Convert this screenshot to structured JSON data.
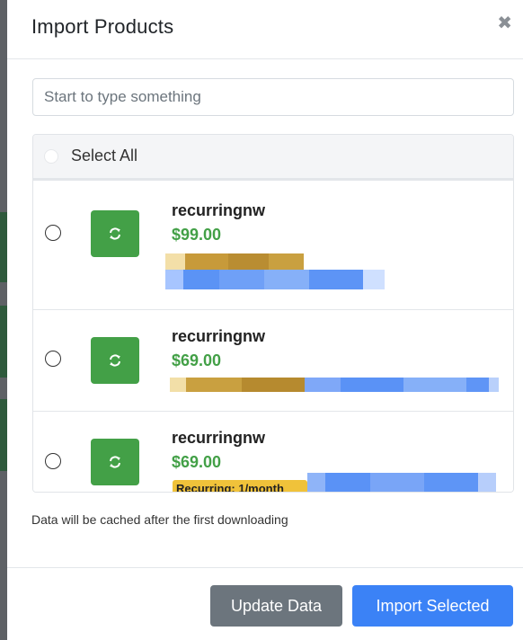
{
  "modal": {
    "title": "Import Products",
    "close_glyph": "✖"
  },
  "search": {
    "placeholder": "Start to type something",
    "value": ""
  },
  "select_all": {
    "label": "Select All"
  },
  "products": [
    {
      "name": "recurringnw",
      "price": "$99.00",
      "badge": ""
    },
    {
      "name": "recurringnw",
      "price": "$69.00",
      "badge": ""
    },
    {
      "name": "recurringnw",
      "price": "$69.00",
      "badge": "Recurring: 1/month"
    }
  ],
  "note": "Data will be cached after the first downloading",
  "buttons": {
    "update": "Update Data",
    "import": "Import Selected"
  },
  "colors": {
    "accent_green": "#43a047",
    "primary_blue": "#3b82f6",
    "secondary_gray": "#6c757d",
    "badge_yellow": "#f0c23a"
  },
  "icons": {
    "sync": "refresh-icon",
    "close": "close-icon"
  }
}
